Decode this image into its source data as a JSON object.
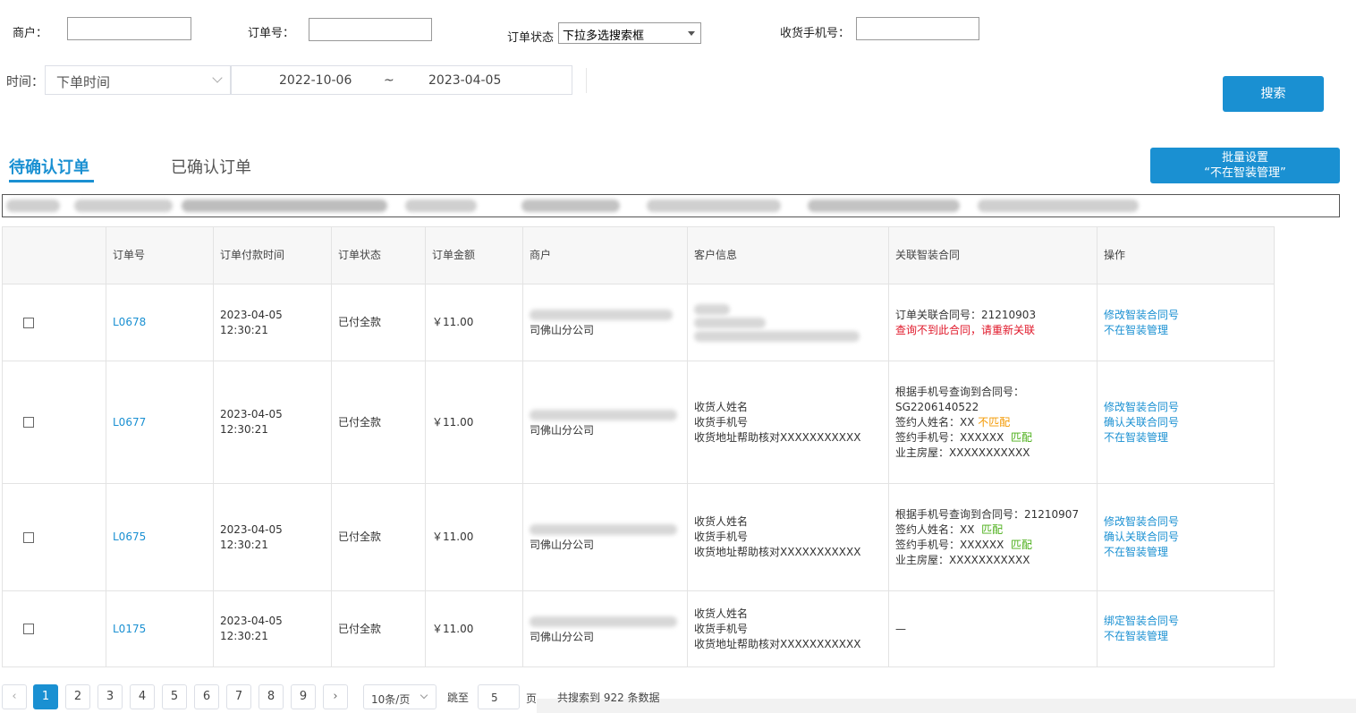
{
  "filters": {
    "merchant_label": "商户：",
    "order_no_label": "订单号：",
    "status_label": "订单状态",
    "status_value": "下拉多选搜索框",
    "phone_label": "收货手机号：",
    "time_label": "时间：",
    "time_type": "下单时间",
    "date_start": "2022-10-06",
    "date_sep": "~",
    "date_end": "2023-04-05",
    "search_button": "搜索"
  },
  "tabs": {
    "pending": "待确认订单",
    "confirmed": "已确认订单"
  },
  "batch_button": {
    "line1": "批量设置",
    "line2": "“不在智装管理”"
  },
  "table": {
    "headers": [
      "",
      "订单号",
      "订单付款时间",
      "订单状态",
      "订单金额",
      "商户",
      "客户信息",
      "关联智装合同",
      "操作"
    ],
    "rows": [
      {
        "order_no": "L0678",
        "pay_time": "2023-04-05 12:30:21",
        "status": "已付全款",
        "amount": "￥11.00",
        "merchant_suffix": "司佛山分公司",
        "contract_line1": "订单关联合同号：21210903",
        "contract_error": "查询不到此合同，请重新关联",
        "actions": [
          "修改智装合同号",
          "不在智装管理"
        ]
      },
      {
        "order_no": "L0677",
        "pay_time": "2023-04-05 12:30:21",
        "status": "已付全款",
        "amount": "￥11.00",
        "merchant_suffix": "司佛山分公司",
        "customer": [
          "收货人姓名",
          "收货手机号",
          "收货地址帮助核对XXXXXXXXXXX"
        ],
        "contract_query": "根据手机号查询到合同号：",
        "contract_no": "SG2206140522",
        "signer_name_label": "签约人姓名：XX",
        "signer_name_match": "不匹配",
        "signer_phone_label": "签约手机号：XXXXXX",
        "signer_phone_match": "匹配",
        "owner_house": "业主房屋：XXXXXXXXXXX",
        "actions": [
          "修改智装合同号",
          "确认关联合同号",
          "不在智装管理"
        ]
      },
      {
        "order_no": "L0675",
        "pay_time": "2023-04-05 12:30:21",
        "status": "已付全款",
        "amount": "￥11.00",
        "merchant_suffix": "司佛山分公司",
        "customer": [
          "收货人姓名",
          "收货手机号",
          "收货地址帮助核对XXXXXXXXXXX"
        ],
        "contract_query": "根据手机号查询到合同号：21210907",
        "signer_name_label": "签约人姓名：XX",
        "signer_name_match": "匹配",
        "signer_phone_label": "签约手机号：XXXXXX",
        "signer_phone_match": "匹配",
        "owner_house": "业主房屋：XXXXXXXXXXX",
        "actions": [
          "修改智装合同号",
          "确认关联合同号",
          "不在智装管理"
        ]
      },
      {
        "order_no": "L0175",
        "pay_time": "2023-04-05 12:30:21",
        "status": "已付全款",
        "amount": "￥11.00",
        "merchant_suffix": "司佛山分公司",
        "customer": [
          "收货人姓名",
          "收货手机号",
          "收货地址帮助核对XXXXXXXXXXX"
        ],
        "contract_empty": "—",
        "actions": [
          "绑定智装合同号",
          "不在智装管理"
        ]
      }
    ]
  },
  "pagination": {
    "prev_icon": "chevron-left-icon",
    "next_icon": "chevron-right-icon",
    "pages": [
      "1",
      "2",
      "3",
      "4",
      "5",
      "6",
      "7",
      "8",
      "9"
    ],
    "current": "1",
    "page_size": "10条/页",
    "jump_label": "跳至",
    "jump_value": "5",
    "jump_unit": "页",
    "total_text": "共搜索到 922 条数据"
  },
  "colors": {
    "accent": "#1a90d2",
    "error": "#e0182a",
    "warning": "#f39800",
    "success": "#4caf1a"
  }
}
